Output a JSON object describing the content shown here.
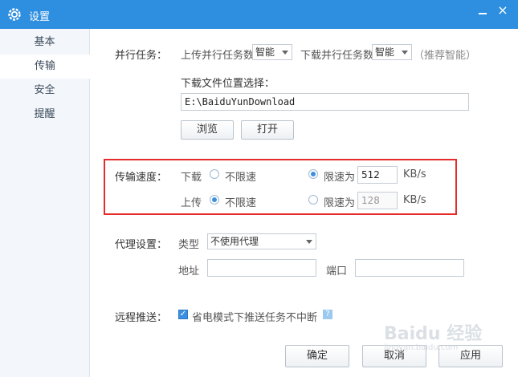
{
  "window": {
    "title": "设置",
    "close_glyph": "×"
  },
  "sidebar": {
    "items": [
      {
        "label": "基本"
      },
      {
        "label": "传输"
      },
      {
        "label": "安全"
      },
      {
        "label": "提醒"
      }
    ]
  },
  "parallel": {
    "label": "并行任务：",
    "upload_label": "上传并行任务数",
    "upload_value": "智能",
    "download_label": "下载并行任务数",
    "download_value": "智能",
    "hint": "（推荐智能）"
  },
  "download_location": {
    "label": "下载文件位置选择：",
    "path": "E:\\BaiduYunDownload",
    "browse_label": "浏览",
    "open_label": "打开"
  },
  "speed": {
    "label": "传输速度：",
    "download": {
      "label": "下载",
      "unlimited_label": "不限速",
      "limited_label": "限速为",
      "value": "512",
      "unit": "KB/s",
      "mode": "limited"
    },
    "upload": {
      "label": "上传",
      "unlimited_label": "不限速",
      "limited_label": "限速为",
      "value": "128",
      "unit": "KB/s",
      "mode": "unlimited"
    }
  },
  "proxy": {
    "label": "代理设置：",
    "type_label": "类型",
    "type_value": "不使用代理",
    "address_label": "地址",
    "port_label": "端口"
  },
  "remote": {
    "label": "远程推送：",
    "checkbox_label": "省电模式下推送任务不中断",
    "checked": true,
    "help_glyph": "?"
  },
  "footer": {
    "ok_label": "确定",
    "cancel_label": "取消",
    "apply_label": "应用"
  },
  "watermark": {
    "text": "Baidu 经验",
    "sub": "jingyan.baidu.com"
  },
  "colors": {
    "titlebar": "#2e8fe0",
    "highlight_box": "#e52b2b",
    "accent": "#3b8fe0"
  }
}
